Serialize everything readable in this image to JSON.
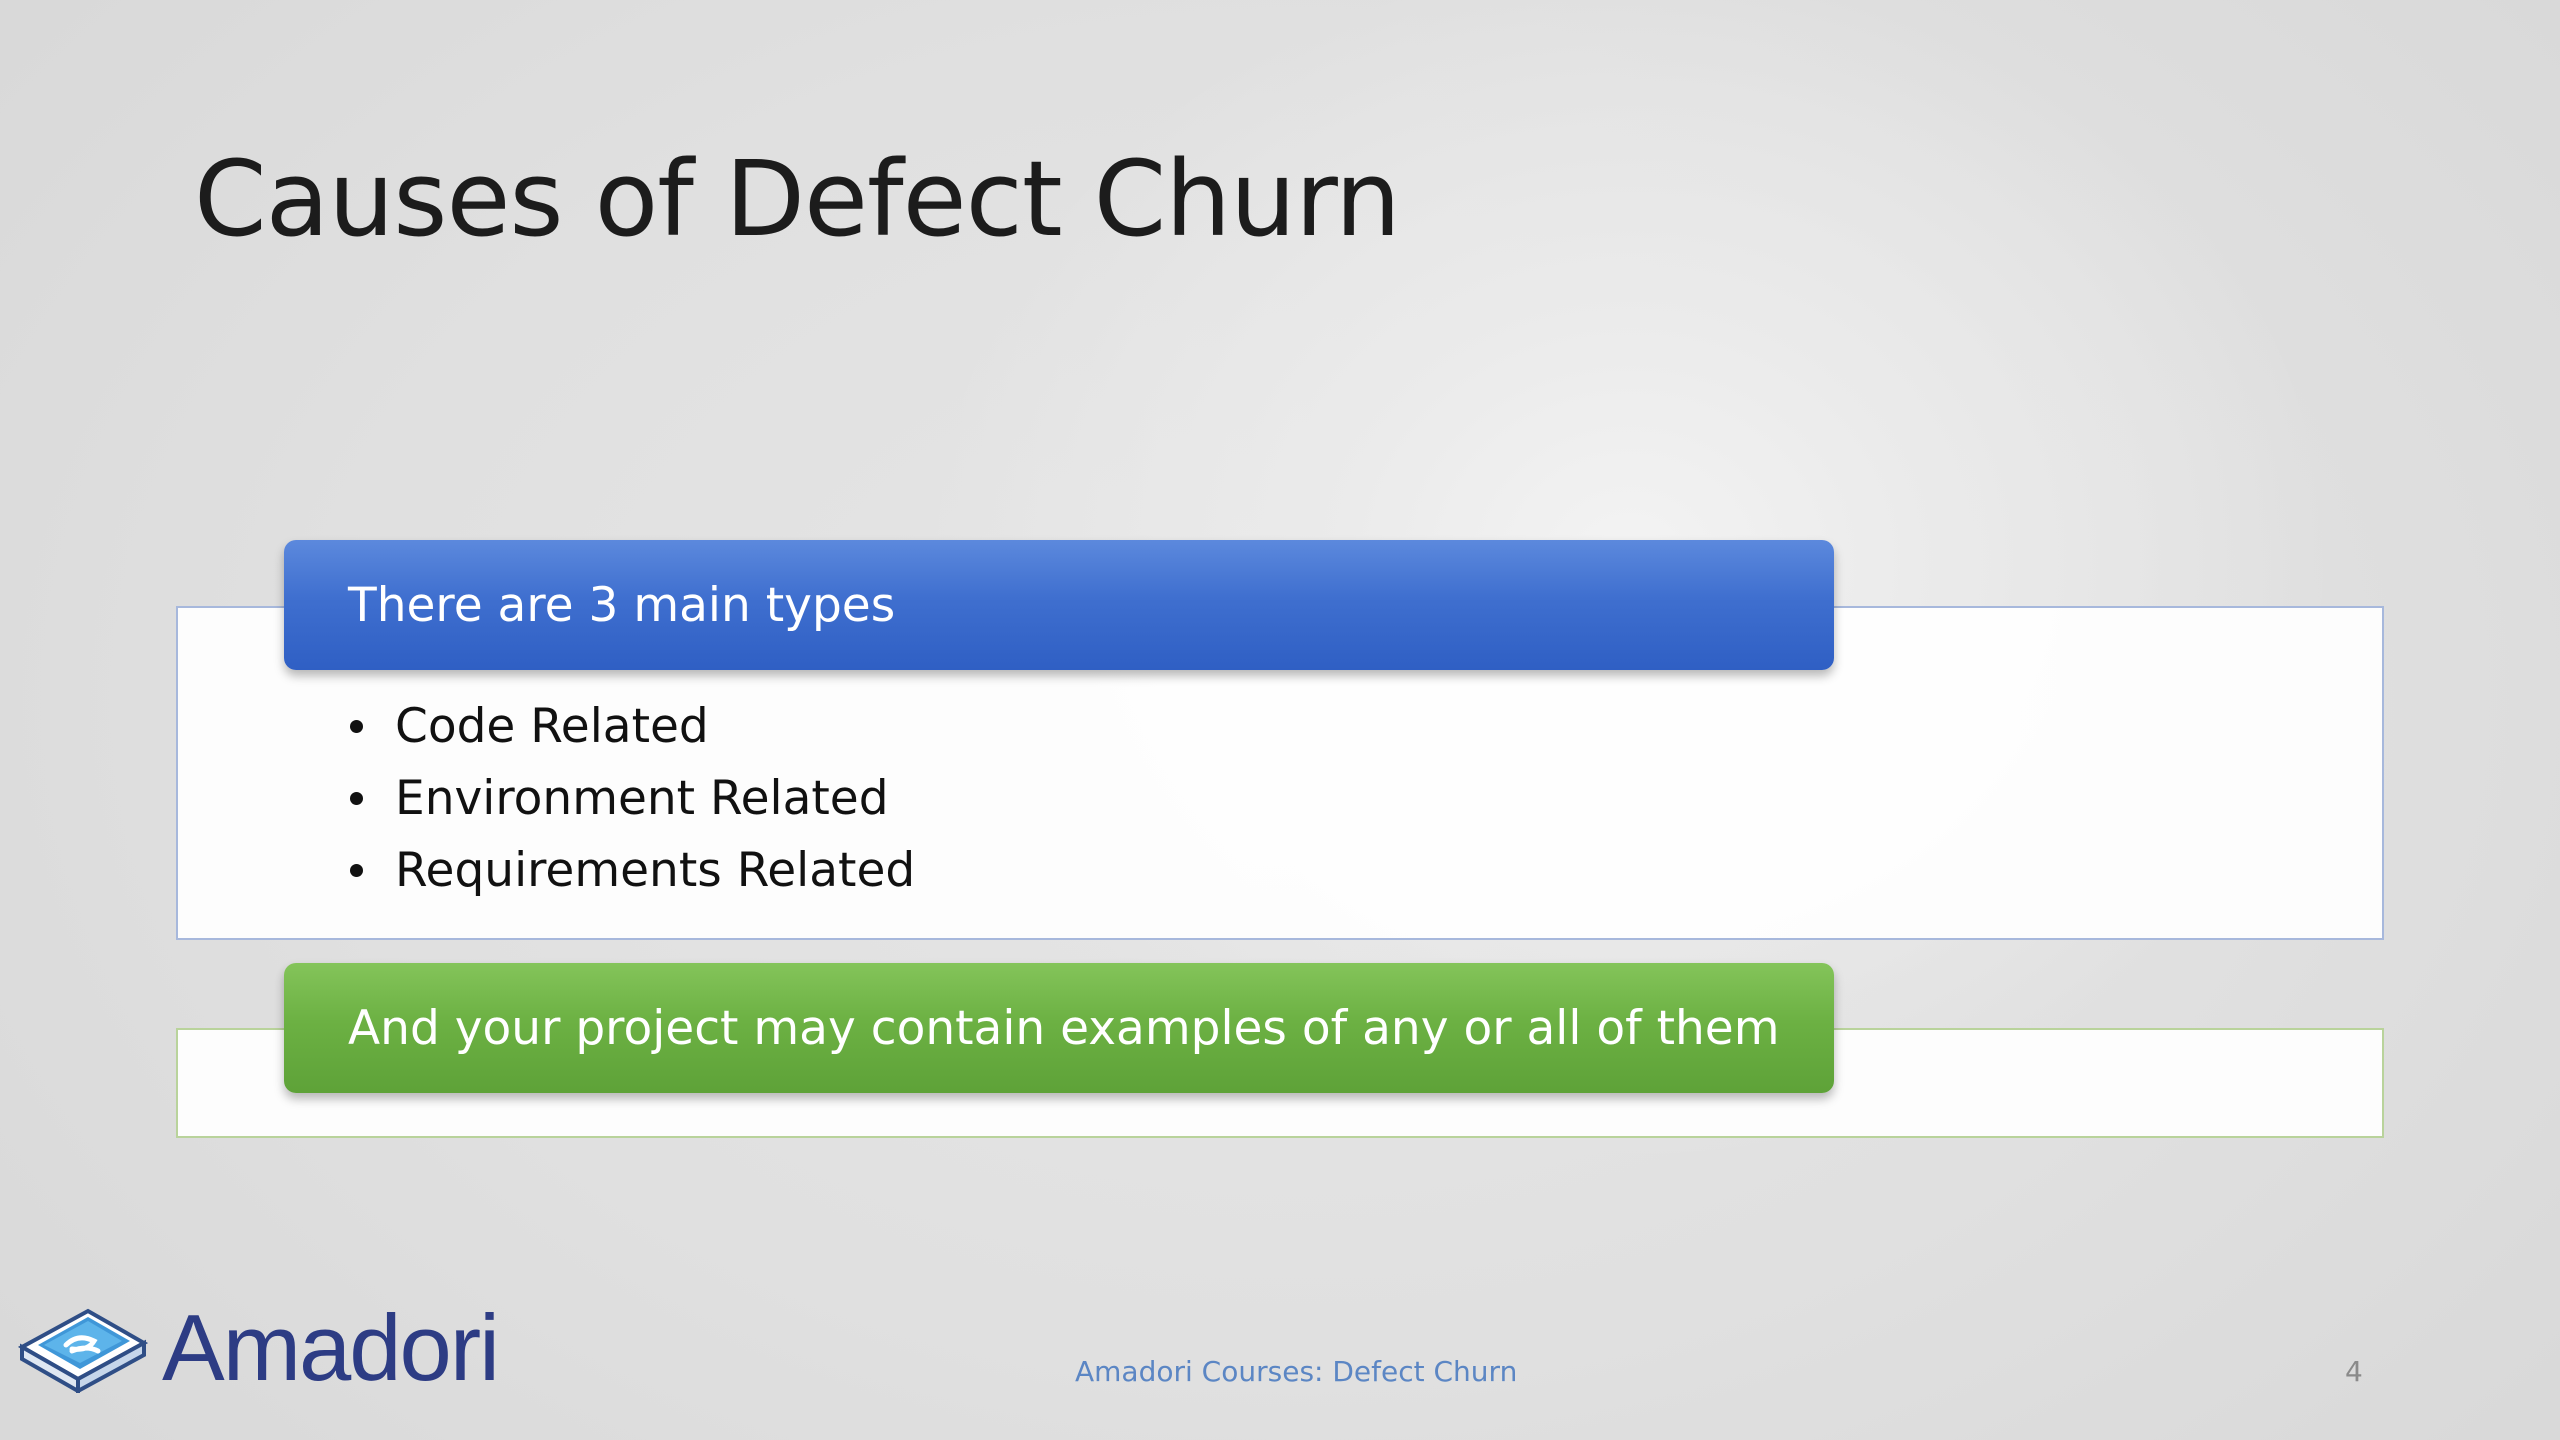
{
  "slide": {
    "title": "Causes of Defect Churn"
  },
  "group1": {
    "header": "There are 3 main types",
    "bullets": [
      "Code Related",
      "Environment Related",
      "Requirements Related"
    ]
  },
  "group2": {
    "header": "And your project may contain examples of any or all of them"
  },
  "footer": {
    "logo_text": "Amadori",
    "center_text": "Amadori Courses: Defect Churn",
    "page_number": "4"
  },
  "colors": {
    "blue_header": "#3f6fcf",
    "green_header": "#6cb143",
    "logo_text": "#2d3c84",
    "footer_text": "#5b86c4"
  },
  "icons": {
    "logo": "amadori-book-logo-icon",
    "bullet": "bullet-dot-icon"
  }
}
